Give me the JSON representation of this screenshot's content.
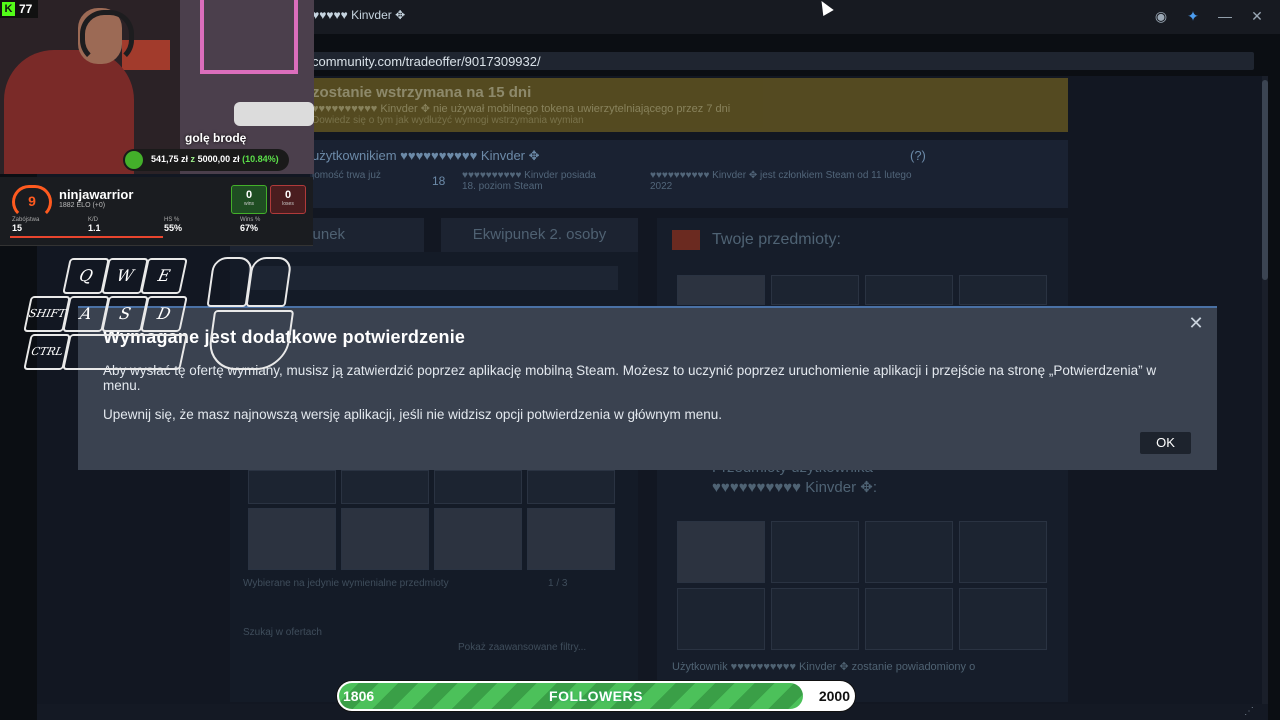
{
  "window": {
    "title": "♥♥♥♥♥♥ Kinvder ✥"
  },
  "url": "community.com/tradeoffer/9017309932/",
  "hold_banner": {
    "title": "zostanie wstrzymana na 15 dni",
    "line": "♥♥♥♥♥♥♥♥♥♥ Kinvder ✥ nie używał mobilnego tokena uwierzytelniającego przez 7 dni",
    "link": "Dowiedz się o tym jak wydłużyć wymogi wstrzymania wymian"
  },
  "partner": {
    "heading": "użytkownikiem ♥♥♥♥♥♥♥♥♥♥ Kinvder ✥",
    "help": "(?)",
    "friends_note": "jomość trwa już",
    "level": "18",
    "level_note": "♥♥♥♥♥♥♥♥♥♥ Kinvder posiada 18. poziom Steam",
    "member_note": "♥♥♥♥♥♥♥♥♥♥ Kinvder ✥ jest członkiem Steam od 11 lutego 2022"
  },
  "tabs": {
    "mine": "wipunek",
    "theirs": "Ekwipunek 2. osoby"
  },
  "inventory": {
    "filter": "Wybierane na jedynie wymienialne przedmioty",
    "page": "1 / 3",
    "search": "Szukaj w ofertach",
    "advanced": "Pokaż zaawansowane filtry..."
  },
  "your_items": {
    "title": "Twoje przedmioty:"
  },
  "their_items": {
    "title": "Przedmioty użytkownika",
    "name": "♥♥♥♥♥♥♥♥♥♥ Kinvder ✥:"
  },
  "notify": "Użytkownik ♥♥♥♥♥♥♥♥♥♥ Kinvder ✥ zostanie powiadomiony o",
  "modal": {
    "title": "Wymagane jest dodatkowe potwierdzenie",
    "p1": "Aby wysłać tę ofertę wymiany, musisz ją zatwierdzić poprzez aplikację mobilną Steam. Możesz to uczynić poprzez uruchomienie aplikacji i przejście na stronę „Potwierdzenia” w menu.",
    "p2": "Upewnij się, że masz najnowszą wersję aplikacji, jeśli nie widzisz opcji potwierdzenia w głównym menu.",
    "ok": "OK",
    "close": "✕"
  },
  "stream": {
    "viewers": "77",
    "challenge": "golę brodę",
    "money_raised": "541,75 zł",
    "money_sep": "z",
    "money_goal": "5000,00 zł",
    "money_pct": "(10.84%)",
    "followers_current": "1806",
    "followers_label": "FOLLOWERS",
    "followers_goal": "2000",
    "followers_progress": 0.903
  },
  "faceit": {
    "level": "9",
    "name": "ninjawarrior",
    "elo": "1882 ELO (+0)",
    "wins": "0",
    "wins_label": "wins",
    "losses": "0",
    "losses_label": "loses",
    "kills_label": "Zabójstwa",
    "kills": "15",
    "kd_label": "K/D",
    "kd": "1.1",
    "hs_label": "HS %",
    "hs": "55%",
    "winrate_label": "Wins %",
    "winrate": "67%"
  },
  "keys": {
    "q": "Q",
    "w": "W",
    "e": "E",
    "shift": "SHIFT",
    "a": "A",
    "s": "S",
    "d": "D",
    "ctrl": "CTRL"
  },
  "colors": {
    "accent": "#4a71a5",
    "modal_bg": "#3a4250",
    "followers_green": "#4cc15a",
    "faceit_orange": "#ff5a1f"
  }
}
